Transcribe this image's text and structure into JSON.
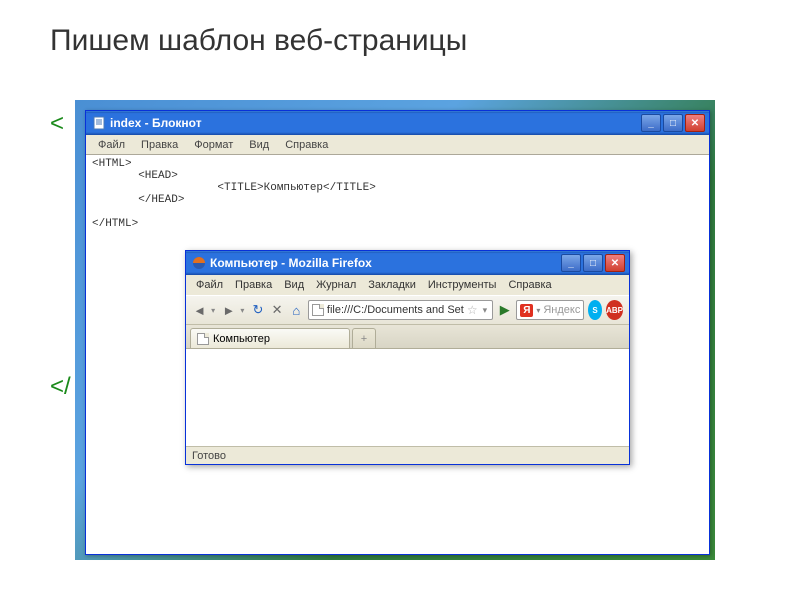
{
  "slide": {
    "title": "Пишем шаблон веб-страницы",
    "bg_fragment_1": "<",
    "bg_fragment_2": "</"
  },
  "notepad": {
    "title": "index - Блокнот",
    "menu": [
      "Файл",
      "Правка",
      "Формат",
      "Вид",
      "Справка"
    ],
    "content": "<HTML>\n       <HEAD>\n                   <TITLE>Компьютер</TITLE>\n       </HEAD>\n\n</HTML>"
  },
  "firefox": {
    "title": "Компьютер - Mozilla Firefox",
    "menu": [
      "Файл",
      "Правка",
      "Вид",
      "Журнал",
      "Закладки",
      "Инструменты",
      "Справка"
    ],
    "url": "file:///C:/Documents and Set",
    "search_engine_glyph": "Я",
    "search_placeholder": "Яндекс",
    "tab_title": "Компьютер",
    "new_tab_glyph": "+",
    "status": "Готово",
    "icons": {
      "back": "◄",
      "forward": "►",
      "reload": "↻",
      "stop": "✕",
      "home": "⌂",
      "go": "▶",
      "abp": "ABP"
    }
  },
  "window_buttons": {
    "minimize": "_",
    "maximize": "□",
    "close": "✕"
  }
}
